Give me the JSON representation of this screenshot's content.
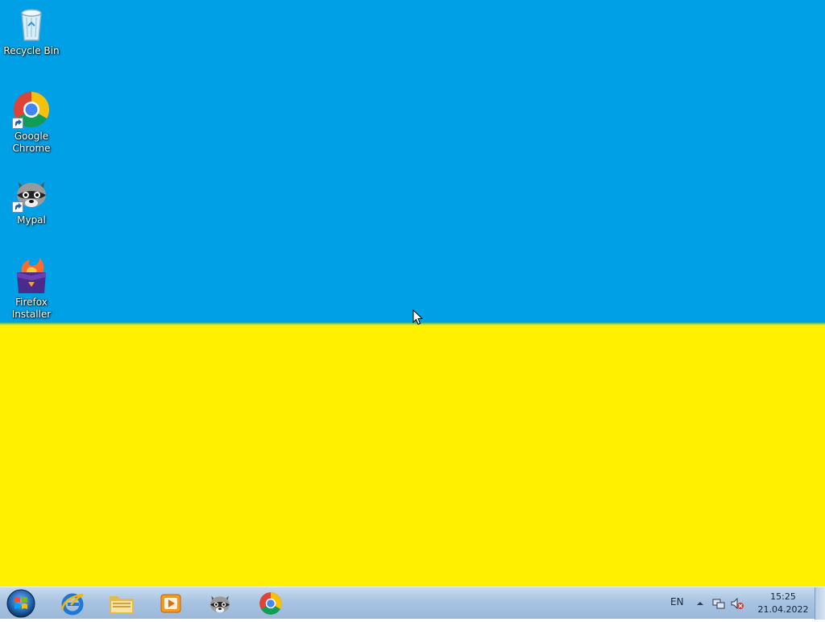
{
  "desktop": {
    "wallpaper_colors": {
      "top": "#00a0e6",
      "bottom": "#fff000"
    },
    "icons": [
      {
        "name": "recycle-bin",
        "label": "Recycle Bin",
        "icon": "recycle-bin-icon"
      },
      {
        "name": "google-chrome",
        "label_line1": "Google",
        "label_line2": "Chrome",
        "icon": "chrome-icon",
        "shortcut": true
      },
      {
        "name": "mypal",
        "label": "Mypal",
        "icon": "raccoon-icon",
        "shortcut": true
      },
      {
        "name": "firefox-installer",
        "label_line1": "Firefox",
        "label_line2": "Installer",
        "icon": "firefox-installer-icon"
      }
    ]
  },
  "taskbar": {
    "start_icon": "windows-orb-icon",
    "pinned": [
      {
        "name": "internet-explorer",
        "icon": "ie-icon"
      },
      {
        "name": "file-explorer",
        "icon": "folder-icon"
      },
      {
        "name": "media-player",
        "icon": "media-player-icon"
      },
      {
        "name": "mypal",
        "icon": "raccoon-icon"
      },
      {
        "name": "google-chrome",
        "icon": "chrome-icon"
      }
    ],
    "tray": {
      "language": "EN",
      "time": "15:25",
      "date": "21.04.2022",
      "icons": [
        "show-hidden-icons-icon",
        "network-icon",
        "volume-muted-icon"
      ]
    },
    "accent": "#a9c4e2"
  }
}
